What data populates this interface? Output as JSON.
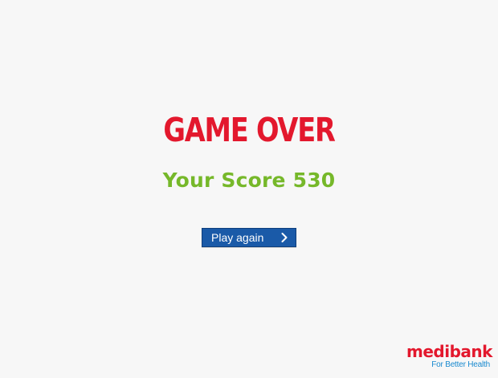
{
  "game_over": {
    "title": "GAME OVER",
    "score_text": "Your Score 530",
    "play_again_label": "Play again",
    "play_again_icon": "chevron-right-icon"
  },
  "brand": {
    "name": "medibank",
    "tagline": "For Better Health"
  },
  "colors": {
    "title": "#e3182d",
    "score": "#76b82a",
    "button": "#1a5aa8",
    "brand_red": "#e3182d",
    "brand_blue": "#1a8acf",
    "background": "#f7f7f7"
  }
}
